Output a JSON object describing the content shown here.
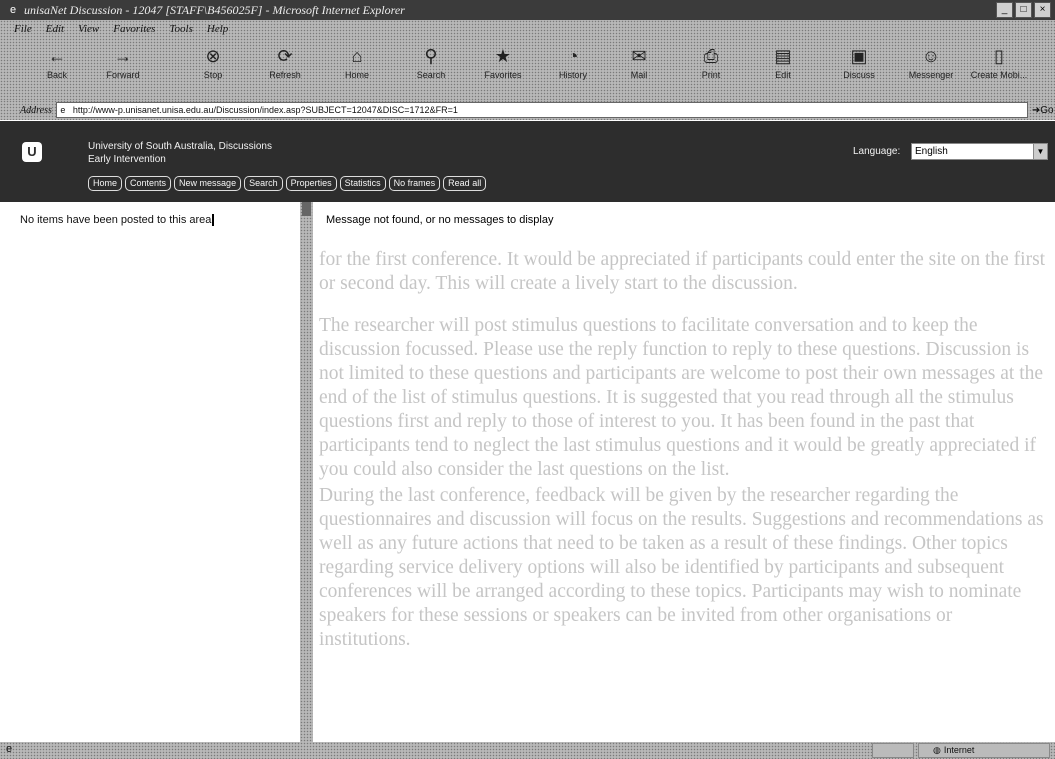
{
  "window": {
    "title": "unisaNet Discussion - 12047 [STAFF\\B456025F] - Microsoft Internet Explorer",
    "buttons": [
      "_",
      "□",
      "×"
    ]
  },
  "menu": [
    "File",
    "Edit",
    "View",
    "Favorites",
    "Tools",
    "Help"
  ],
  "toolbar": [
    "Back",
    "Forward",
    "Stop",
    "Refresh",
    "Home",
    "Search",
    "Favorites",
    "History",
    "Mail",
    "Print",
    "Edit",
    "Discuss",
    "Messenger",
    "Create Mobi..."
  ],
  "address": {
    "label": "Address",
    "url": "http://www-p.unisanet.unisa.edu.au/Discussion/index.asp?SUBJECT=12047&DISC=1712&FR=1",
    "go": "Go"
  },
  "site": {
    "title": "University of South Australia, Discussions",
    "subtitle": "Early Intervention",
    "nav": [
      "Home",
      "Contents",
      "New message",
      "Search",
      "Properties",
      "Statistics",
      "No frames",
      "Read all"
    ],
    "language_label": "Language:",
    "language_value": "English"
  },
  "left_pane": {
    "message": "No items have been posted to this area"
  },
  "right_pane": {
    "message": "Message not found, or no messages to display",
    "background_paragraphs": [
      "for the first conference. It would be appreciated if participants could enter the site on the first or second day. This will create a lively start to the discussion.",
      "The researcher will post stimulus questions to facilitate conversation and to keep the discussion focussed. Please use the reply function to reply to these questions. Discussion is not limited to these questions and participants are welcome to post their own messages at the end of the list of stimulus questions. It is suggested that you read through all the stimulus questions first and reply to those of interest to you. It has been found in the past that participants tend to neglect the last stimulus questions and it would be greatly appreciated if you could also consider the last questions on the list.",
      "During the last conference, feedback will be given by the researcher regarding the questionnaires and discussion will focus on the results. Suggestions and recommendations as well as any future actions that need to be taken as a result of these findings. Other topics regarding service delivery options will also be identified by participants and subsequent conferences will be arranged according to these topics. Participants may wish to nominate speakers for these sessions or speakers can be invited from other organisations or institutions."
    ]
  },
  "status": {
    "zone": "Internet"
  }
}
